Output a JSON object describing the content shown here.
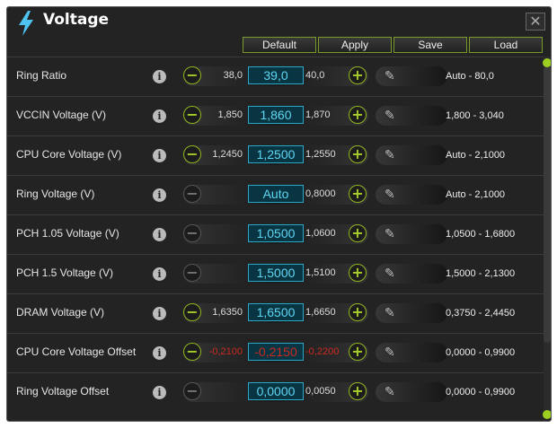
{
  "window": {
    "title": "Voltage",
    "icon": "lightning-bolt-icon",
    "close_label": "✕"
  },
  "toolbar": {
    "default_label": "Default",
    "apply_label": "Apply",
    "save_label": "Save",
    "load_label": "Load"
  },
  "info_glyph": "i",
  "pencil_glyph": "✎",
  "minus_glyph": "−",
  "plus_glyph": "+",
  "colors": {
    "accent": "#8fb520",
    "value_highlight": "#5fd7f2",
    "negative": "#cc2a1f"
  },
  "rows": [
    {
      "label": "Ring Ratio",
      "prev": "38,0",
      "current": "39,0",
      "next": "40,0",
      "range": "Auto - 80,0",
      "minus_enabled": true
    },
    {
      "label": "VCCIN Voltage (V)",
      "prev": "1,850",
      "current": "1,860",
      "next": "1,870",
      "range": "1,800 - 3,040",
      "minus_enabled": true
    },
    {
      "label": "CPU Core Voltage (V)",
      "prev": "1,2450",
      "current": "1,2500",
      "next": "1,2550",
      "range": "Auto - 2,1000",
      "minus_enabled": true
    },
    {
      "label": "Ring Voltage (V)",
      "prev": "",
      "current": "Auto",
      "next": "0,8000",
      "range": "Auto - 2,1000",
      "minus_enabled": false
    },
    {
      "label": "PCH 1.05 Voltage (V)",
      "prev": "",
      "current": "1,0500",
      "next": "1,0600",
      "range": "1,0500 - 1,6800",
      "minus_enabled": false
    },
    {
      "label": "PCH 1.5 Voltage (V)",
      "prev": "",
      "current": "1,5000",
      "next": "1,5100",
      "range": "1,5000 - 2,1300",
      "minus_enabled": false
    },
    {
      "label": "DRAM Voltage (V)",
      "prev": "1,6350",
      "current": "1,6500",
      "next": "1,6650",
      "range": "0,3750 - 2,4450",
      "minus_enabled": true
    },
    {
      "label": "CPU Core Voltage Offset",
      "prev": "-0,2100",
      "current": "-0,2150",
      "next": "-0,2200",
      "range": "0,0000 - 0,9900",
      "minus_enabled": true,
      "negative": true
    },
    {
      "label": "Ring Voltage Offset",
      "prev": "",
      "current": "0,0000",
      "next": "0,0050",
      "range": "0,0000 - 0,9900",
      "minus_enabled": false
    }
  ]
}
